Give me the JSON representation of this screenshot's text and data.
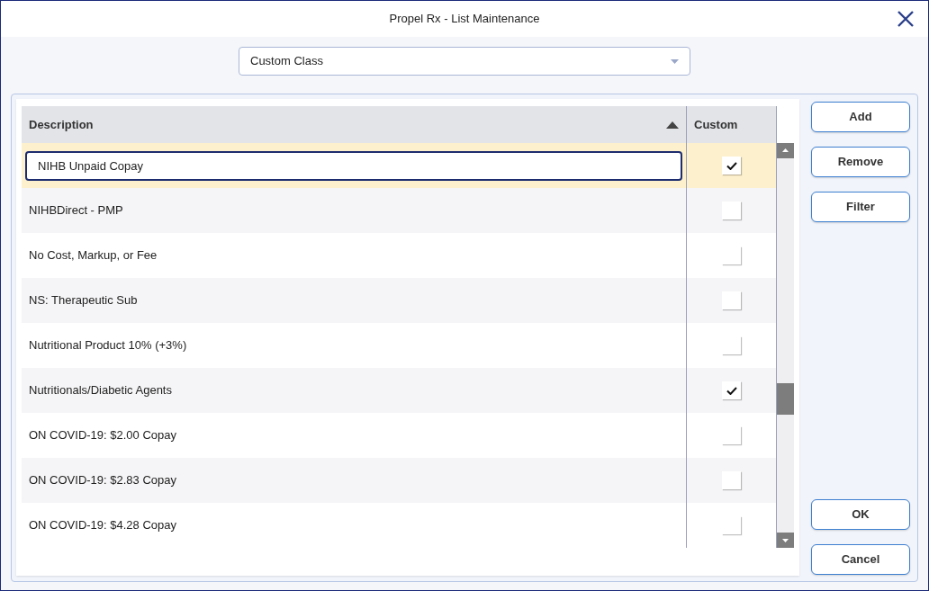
{
  "window": {
    "title": "Propel Rx - List Maintenance"
  },
  "list_selector": {
    "value": "Custom Class"
  },
  "table": {
    "columns": [
      {
        "label": "Description",
        "sort_ascending": true
      },
      {
        "label": "Custom"
      }
    ],
    "rows": [
      {
        "description": "NIHB Unpaid Copay",
        "custom": true,
        "selected": true,
        "editing": true
      },
      {
        "description": "NIHBDirect - PMP",
        "custom": false,
        "selected": false,
        "editing": false
      },
      {
        "description": "No Cost, Markup, or Fee",
        "custom": false,
        "selected": false,
        "editing": false
      },
      {
        "description": "NS: Therapeutic Sub",
        "custom": false,
        "selected": false,
        "editing": false
      },
      {
        "description": "Nutritional Product 10% (+3%)",
        "custom": false,
        "selected": false,
        "editing": false
      },
      {
        "description": "Nutritionals/Diabetic Agents",
        "custom": true,
        "selected": false,
        "editing": false
      },
      {
        "description": "ON COVID-19: $2.00 Copay",
        "custom": false,
        "selected": false,
        "editing": false
      },
      {
        "description": "ON COVID-19: $2.83 Copay",
        "custom": false,
        "selected": false,
        "editing": false
      },
      {
        "description": "ON COVID-19: $4.28 Copay",
        "custom": false,
        "selected": false,
        "editing": false
      }
    ]
  },
  "side_buttons": [
    "Add",
    "Remove",
    "Filter"
  ],
  "footer_buttons": [
    "OK",
    "Cancel"
  ]
}
